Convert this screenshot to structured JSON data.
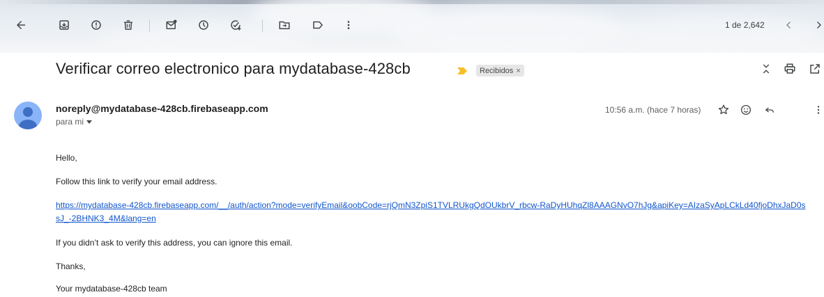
{
  "toolbar": {
    "pager_text": "1 de 2,642",
    "icons": [
      "back-arrow-icon",
      "archive-icon",
      "report-spam-icon",
      "delete-icon",
      "mark-unread-icon",
      "snooze-icon",
      "add-task-icon",
      "move-to-icon",
      "label-icon",
      "more-vert-icon",
      "newer-chevron-icon",
      "older-chevron-icon"
    ]
  },
  "message": {
    "subject": "Verificar correo electronico para mydatabase-428cb",
    "label": "Recibidos",
    "label_remove": "×",
    "sender": "noreply@mydatabase-428cb.firebaseapp.com",
    "recipient": "para mi",
    "timestamp": "10:56 a.m. (hace 7 horas)",
    "body": {
      "greeting": "Hello,",
      "instruction": "Follow this link to verify your email address.",
      "link": "https://mydatabase-428cb.firebaseapp.com/__/auth/action?mode=verifyEmail&oobCode=rjQmN3ZpiS1TVLRUkgQdOUkbrV_rbcw-RaDyHUhqZl8AAAGNvO7hJg&apiKey=AIzaSyApLCkLd40fjoDhxJaD0ssJ_-2BHNK3_4M&lang=en",
      "ignore": "If you didn’t ask to verify this address, you can ignore this email.",
      "thanks": "Thanks,",
      "signature": "Your mydatabase-428cb team"
    }
  },
  "colors": {
    "link": "#1155cc",
    "importance": "#f6bf26",
    "avatar": "#8ab4f8"
  }
}
